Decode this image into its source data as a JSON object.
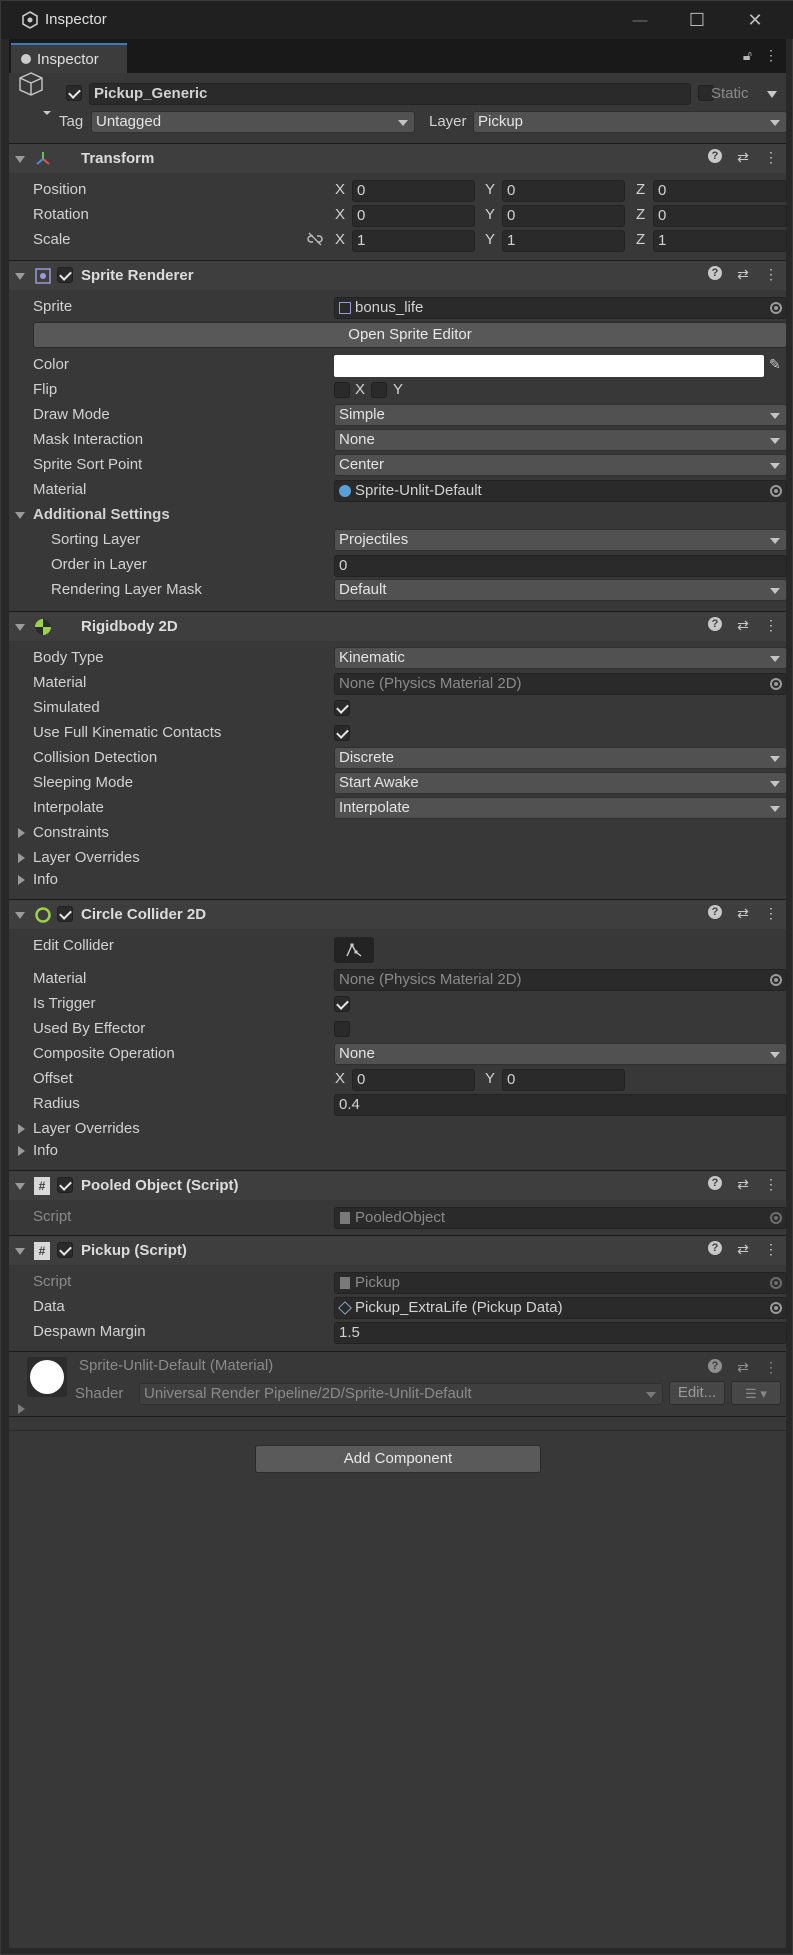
{
  "window": {
    "title": "Inspector",
    "minimize": "—",
    "maximize": "☐",
    "close": "✕"
  },
  "tab": {
    "label": "Inspector",
    "icon": "info-icon",
    "lock": "lock-icon",
    "menu": "⋮"
  },
  "gameobject": {
    "name": "Pickup_Generic",
    "active": true,
    "static_label": "Static",
    "tag_label": "Tag",
    "tag_value": "Untagged",
    "layer_label": "Layer",
    "layer_value": "Pickup"
  },
  "transform": {
    "title": "Transform",
    "position_label": "Position",
    "rotation_label": "Rotation",
    "scale_label": "Scale",
    "x": "X",
    "y": "Y",
    "z": "Z",
    "position": [
      "0",
      "0",
      "0"
    ],
    "rotation": [
      "0",
      "0",
      "0"
    ],
    "scale": [
      "1",
      "1",
      "1"
    ]
  },
  "sprite_renderer": {
    "title": "Sprite Renderer",
    "sprite_label": "Sprite",
    "sprite_value": "bonus_life",
    "open_editor": "Open Sprite Editor",
    "color_label": "Color",
    "color_value": "#ffffff",
    "flip_label": "Flip",
    "flip_x": "X",
    "flip_y": "Y",
    "draw_mode_label": "Draw Mode",
    "draw_mode": "Simple",
    "mask_label": "Mask Interaction",
    "mask": "None",
    "sort_point_label": "Sprite Sort Point",
    "sort_point": "Center",
    "material_label": "Material",
    "material": "Sprite-Unlit-Default",
    "additional": "Additional Settings",
    "sorting_layer_label": "Sorting Layer",
    "sorting_layer": "Projectiles",
    "order_label": "Order in Layer",
    "order": "0",
    "rendering_mask_label": "Rendering Layer Mask",
    "rendering_mask": "Default"
  },
  "rigidbody": {
    "title": "Rigidbody 2D",
    "body_type_label": "Body Type",
    "body_type": "Kinematic",
    "material_label": "Material",
    "material": "None (Physics Material 2D)",
    "simulated_label": "Simulated",
    "full_kinematic_label": "Use Full Kinematic Contacts",
    "collision_label": "Collision Detection",
    "collision": "Discrete",
    "sleeping_label": "Sleeping Mode",
    "sleeping": "Start Awake",
    "interpolate_label": "Interpolate",
    "interpolate": "Interpolate",
    "constraints": "Constraints",
    "layer_overrides": "Layer Overrides",
    "info": "Info"
  },
  "circle_collider": {
    "title": "Circle Collider 2D",
    "edit_label": "Edit Collider",
    "material_label": "Material",
    "material": "None (Physics Material 2D)",
    "trigger_label": "Is Trigger",
    "effector_label": "Used By Effector",
    "composite_label": "Composite Operation",
    "composite": "None",
    "offset_label": "Offset",
    "offset_x": "0",
    "offset_y": "0",
    "radius_label": "Radius",
    "radius": "0.4",
    "layer_overrides": "Layer Overrides",
    "info": "Info"
  },
  "pooled_object": {
    "title": "Pooled Object (Script)",
    "script_label": "Script",
    "script": "PooledObject"
  },
  "pickup_script": {
    "title": "Pickup (Script)",
    "script_label": "Script",
    "script": "Pickup",
    "data_label": "Data",
    "data": "Pickup_ExtraLife (Pickup Data)",
    "margin_label": "Despawn Margin",
    "margin": "1.5"
  },
  "material_asset": {
    "title": "Sprite-Unlit-Default (Material)",
    "shader_label": "Shader",
    "shader": "Universal Render Pipeline/2D/Sprite-Unlit-Default",
    "edit": "Edit..."
  },
  "add_component": "Add Component",
  "colors": {
    "accent": "#3a79bb",
    "panel": "#383838",
    "header": "#3e3e3e",
    "field": "#2a2a2a"
  }
}
